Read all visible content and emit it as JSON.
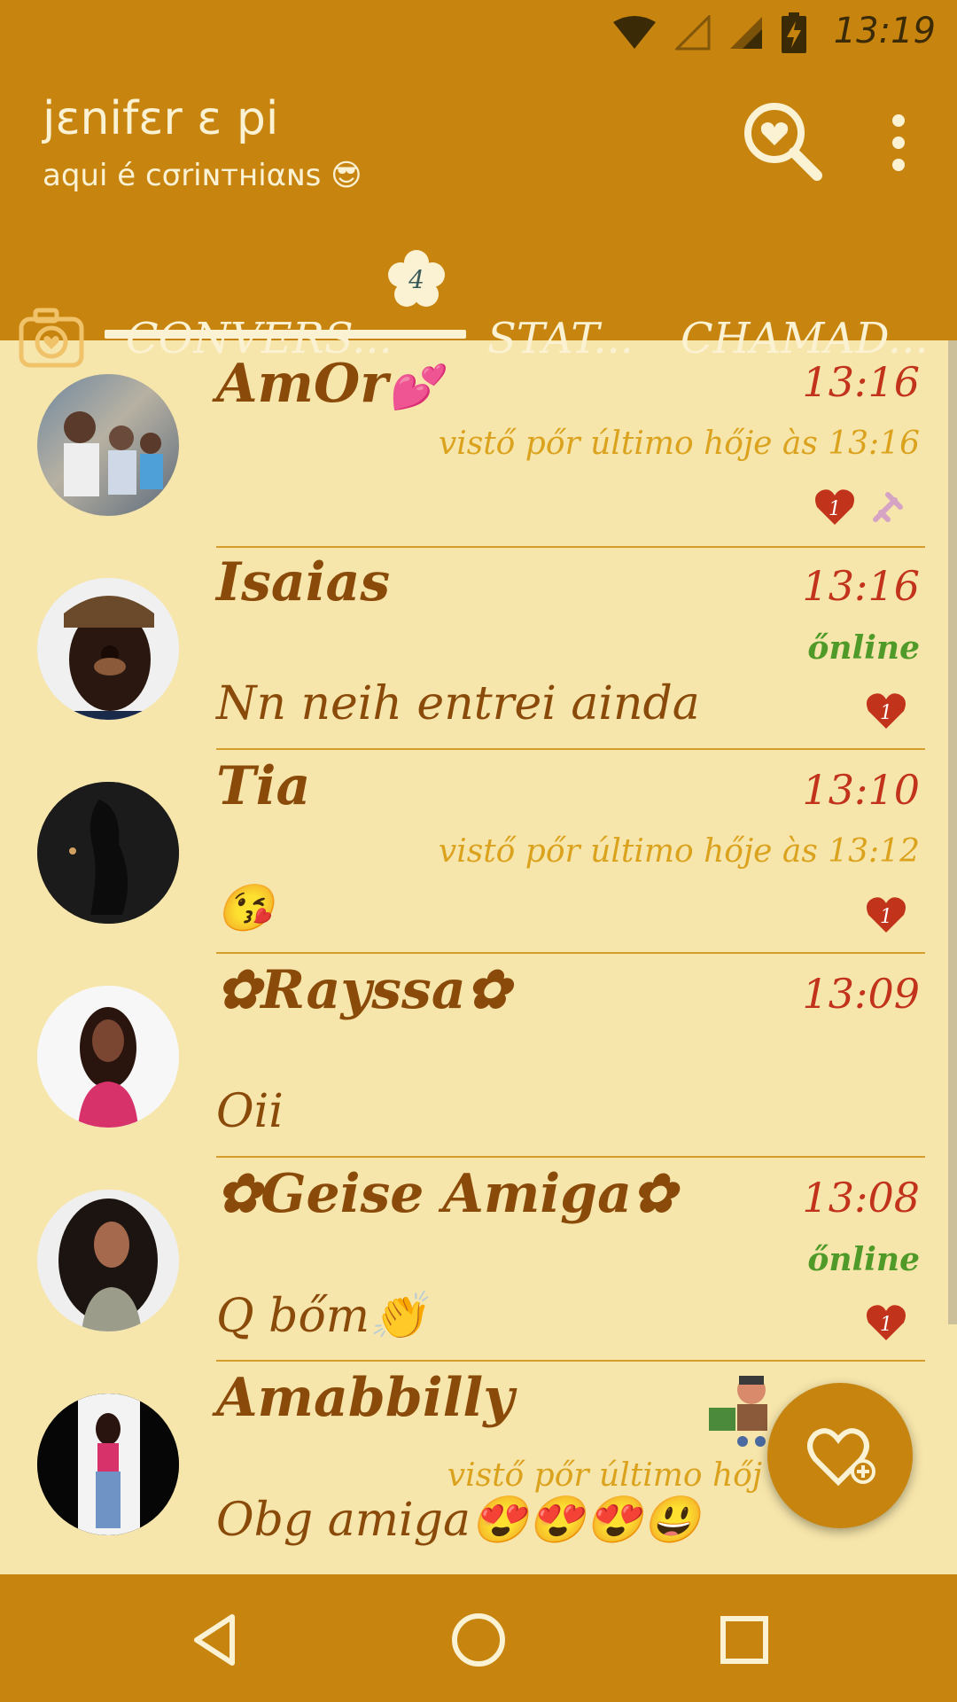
{
  "status_bar": {
    "time": "13:19",
    "icons": [
      "wifi-icon",
      "signal-empty-icon",
      "signal-icon",
      "battery-charging-icon"
    ]
  },
  "app_bar": {
    "title": "jɛnifɛr ɛ pi",
    "subtitle": "aqui é cσriɴтнiαɴs 😎",
    "actions": [
      "search-heart-icon",
      "more-vert-icon"
    ]
  },
  "tabs": {
    "items": [
      {
        "label": "CONVERS...",
        "badge": "4"
      },
      {
        "label": "STAT..."
      },
      {
        "label": "CHAMAD..."
      }
    ],
    "active": 0
  },
  "chats": [
    {
      "name": "AmOr",
      "time": "13:16",
      "status": "vistő pőr último hője às 13:16",
      "status_type": "seen",
      "message": "",
      "unread": "1"
    },
    {
      "name": "Isaias",
      "time": "13:16",
      "status": "őnline",
      "status_type": "online",
      "message": "Nn neih entrei ainda",
      "unread": "1"
    },
    {
      "name": "Tia",
      "time": "13:10",
      "status": "vistő pőr último hője às 13:12",
      "status_type": "seen",
      "message": "😘",
      "unread": "1"
    },
    {
      "name": "✿Rayssa✿",
      "time": "13:09",
      "status": "",
      "status_type": "",
      "message": "Oii",
      "unread": ""
    },
    {
      "name": "✿Geise Amiga✿",
      "time": "13:08",
      "status": "őnline",
      "status_type": "online",
      "message": "Q bőm👏",
      "unread": "1"
    },
    {
      "name": "Amabbilly",
      "time": "",
      "status": "vistő pőr último hőj",
      "status_type": "seen",
      "message": "Obg amiga😍😍😍😃",
      "unread": ""
    }
  ],
  "colors": {
    "primary": "#c7840f",
    "background": "#f7e6ab",
    "name": "#8a4a0a",
    "time": "#c2331c",
    "seen": "#dba21e",
    "online": "#4f9a28",
    "unread": "#c2331c"
  },
  "fab": {
    "icon": "heart-add-icon"
  },
  "nav": [
    "back-icon",
    "home-icon",
    "recents-icon"
  ]
}
